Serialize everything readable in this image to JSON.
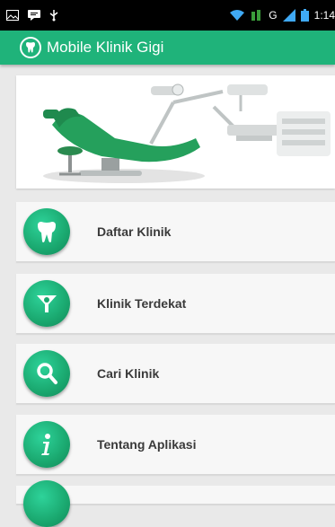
{
  "status_bar": {
    "time": "1:14",
    "network_label": "G",
    "icons": [
      "image-icon",
      "message-icon",
      "usb-icon",
      "wifi-icon",
      "data-icon",
      "signal-icon",
      "battery-icon"
    ]
  },
  "app_bar": {
    "title": "Mobile Klinik Gigi",
    "logo_icon": "tooth-icon",
    "background": "#1fb37a"
  },
  "banner": {
    "image": "dental-chair-image"
  },
  "menu": {
    "items": [
      {
        "label": "Daftar Klinik",
        "icon": "tooth-icon"
      },
      {
        "label": "Klinik Terdekat",
        "icon": "location-pin-icon"
      },
      {
        "label": "Cari Klinik",
        "icon": "search-icon"
      },
      {
        "label": "Tentang Aplikasi",
        "icon": "info-icon"
      }
    ]
  }
}
